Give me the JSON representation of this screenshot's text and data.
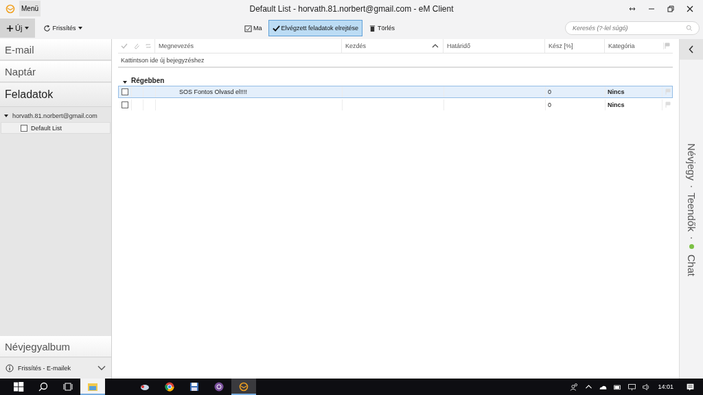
{
  "window": {
    "menu": "Menü",
    "title": "Default List - horvath.81.norbert@gmail.com - eM Client"
  },
  "toolbar": {
    "new": "Új",
    "refresh": "Frissítés",
    "today": "Ma",
    "hide_completed": {
      "label": "Elvégzett feladatok elrejtése",
      "on": true
    },
    "delete": "Törlés",
    "search": {
      "placeholder": "Keresés (?-lel súgó)"
    }
  },
  "sidebar": {
    "sections": [
      {
        "label": "E-mail",
        "selected": false
      },
      {
        "label": "Naptár",
        "selected": false
      },
      {
        "label": "Feladatok",
        "selected": true
      }
    ],
    "tree": [
      {
        "label": "horvath.81.norbert@gmail.com",
        "expanded": true,
        "children": [
          {
            "label": "Default List",
            "checked": false
          }
        ]
      }
    ],
    "bottom_section": {
      "label": "Névjegyalbum",
      "selected": false
    },
    "status": "Frissítés - E-mailek"
  },
  "table": {
    "columns": [
      {
        "label": "Megnevezés",
        "sorted": false
      },
      {
        "label": "Kezdés",
        "sorted": true
      },
      {
        "label": "Határidő",
        "sorted": false
      },
      {
        "label": "Kész [%]",
        "sorted": false
      },
      {
        "label": "Kategória",
        "sorted": false
      }
    ],
    "new_entry": "Kattintson ide új bejegyzéshez",
    "groups": [
      {
        "label": "Régebben",
        "expanded": true,
        "rows": [
          {
            "checked": false,
            "selected": true,
            "name": "SOS Fontos Olvasd el!!!!",
            "done": "0",
            "category": "Nincs"
          },
          {
            "checked": false,
            "selected": false,
            "done": "0",
            "category": "Nincs"
          }
        ]
      }
    ]
  },
  "right_panel": {
    "items": [
      {
        "label": "Névjegy",
        "kind": "plain"
      },
      {
        "label": "Teendők",
        "kind": "plain"
      },
      {
        "label": "Chat",
        "kind": "online"
      }
    ]
  },
  "taskbar": {
    "time": "14:01"
  }
}
